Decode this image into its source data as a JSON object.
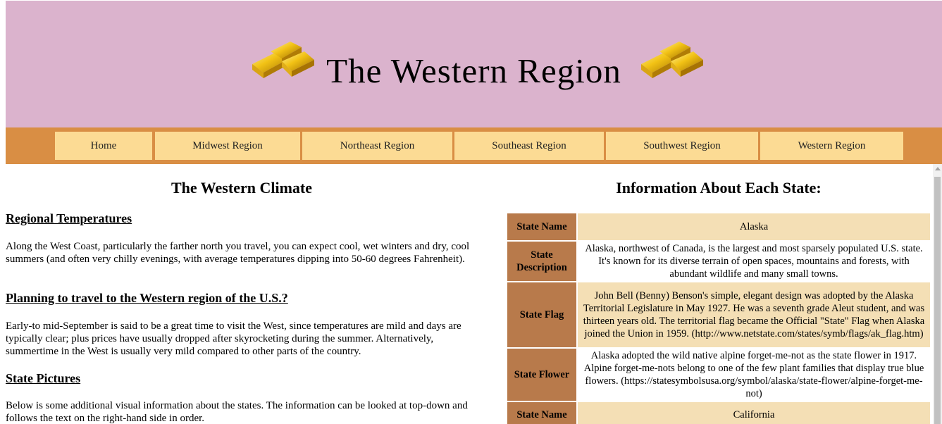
{
  "header": {
    "title": "The Western Region"
  },
  "nav": {
    "items": [
      {
        "label": "Home"
      },
      {
        "label": "Midwest Region"
      },
      {
        "label": "Northeast Region"
      },
      {
        "label": "Southeast Region"
      },
      {
        "label": "Southwest Region"
      },
      {
        "label": "Western Region"
      }
    ]
  },
  "climate": {
    "heading": "The Western Climate",
    "sections": [
      {
        "title": "Regional Temperatures",
        "text": "Along the West Coast, particularly the farther north you travel, you can expect cool, wet winters and dry, cool summers (and often very chilly evenings, with average temperatures dipping into 50-60 degrees Fahrenheit)."
      },
      {
        "title": "Planning to travel to the Western region of the U.S.?",
        "text": "Early-to mid-September is said to be a great time to visit the West, since temperatures are mild and days are typically clear; plus prices have usually dropped after skyrocketing during the summer. Alternatively, summertime in the West is usually very mild compared to other parts of the country."
      },
      {
        "title": "State Pictures",
        "text": "Below is some additional visual information about the states. The information can be looked at top-down and follows the text on the right-hand side in order."
      }
    ]
  },
  "info": {
    "heading": "Information About Each State:",
    "rows": [
      {
        "label": "State Name",
        "value": "Alaska"
      },
      {
        "label": "State Description",
        "value": "Alaska, northwest of Canada, is the largest and most sparsely populated U.S. state. It's known for its diverse terrain of open spaces, mountains and forests, with abundant wildlife and many small towns."
      },
      {
        "label": "State Flag",
        "value": "John Bell (Benny) Benson's simple, elegant design was adopted by the Alaska Territorial Legislature in May 1927. He was a seventh grade Aleut student, and was thirteen years old. The territorial flag became the Official \"State\" Flag when Alaska joined the Union in 1959. (http://www.netstate.com/states/symb/flags/ak_flag.htm)"
      },
      {
        "label": "State Flower",
        "value": "Alaska adopted the wild native alpine forget-me-not as the state flower in 1917. Alpine forget-me-nots belong to one of the few plant families that display true blue flowers. (https://statesymbolsusa.org/symbol/alaska/state-flower/alpine-forget-me-not)"
      },
      {
        "label": "State Name",
        "value": "California"
      }
    ]
  },
  "colors": {
    "banner": "#dbb3cd",
    "nav_bar": "#d98e44",
    "nav_item": "#fcdb94",
    "table_header": "#b87a4b",
    "table_cell_tan": "#f4dfb5"
  },
  "icons": [
    "gold-bars-icon"
  ]
}
